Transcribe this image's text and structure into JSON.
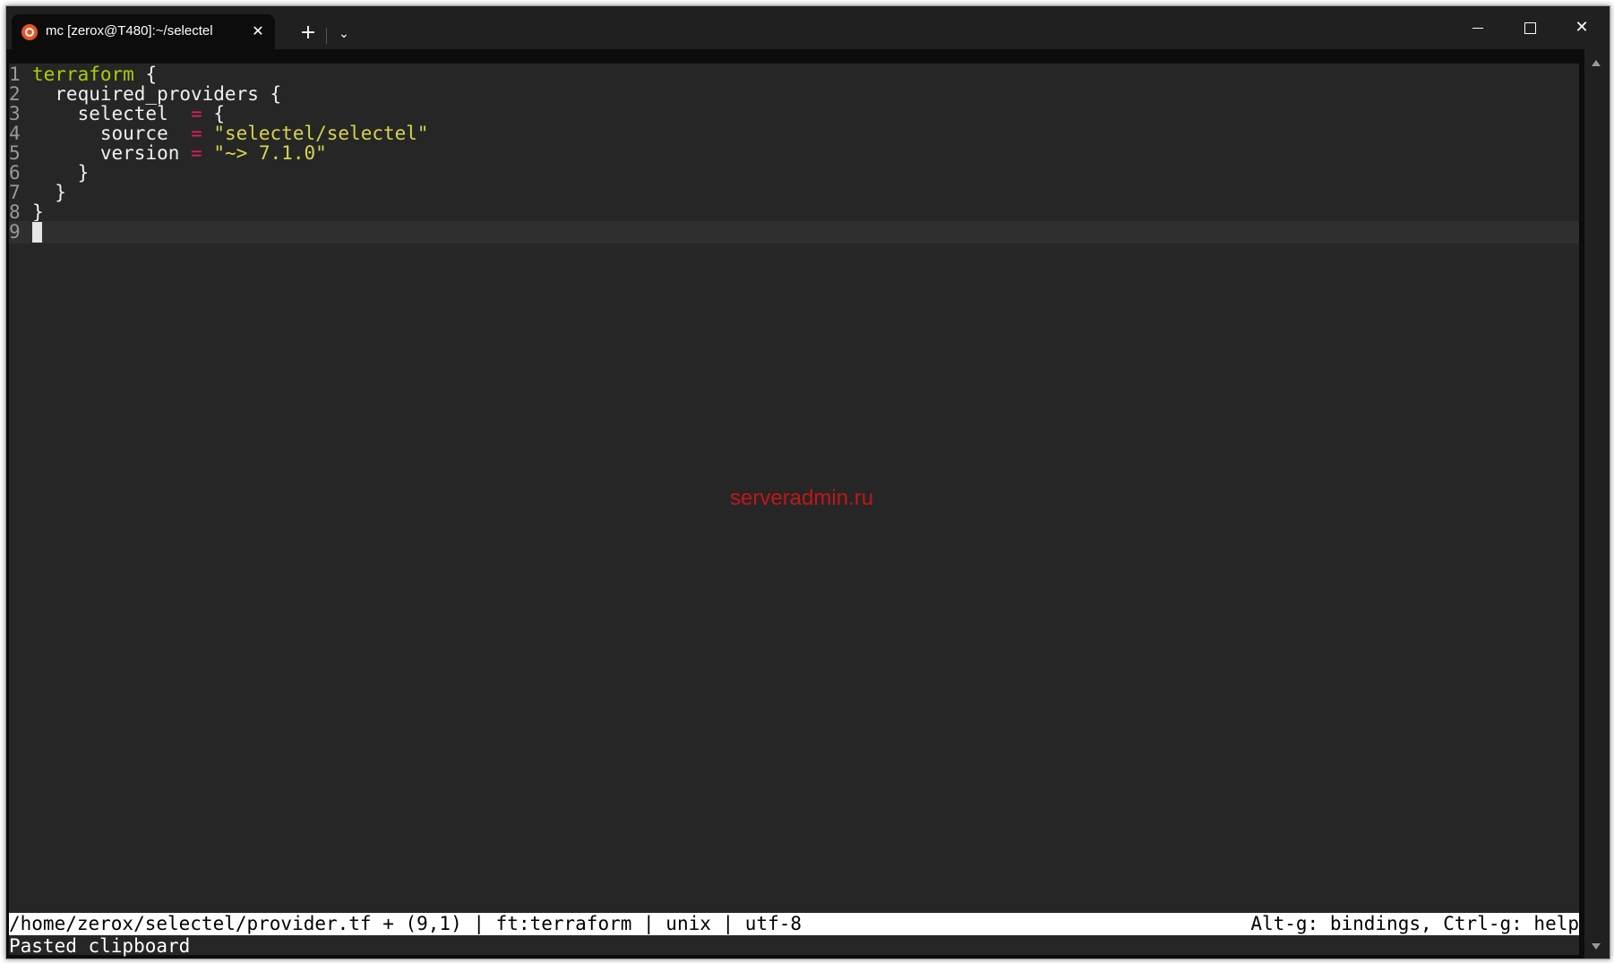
{
  "window": {
    "tab_title": "mc [zerox@T480]:~/selectel",
    "tab_icon": "ubuntu-logo",
    "close_glyph": "✕",
    "new_tab_glyph": "+",
    "dropdown_glyph": "⌄",
    "window_close_glyph": "✕"
  },
  "editor": {
    "lines": [
      {
        "num": "1",
        "tokens": [
          {
            "t": "terraform",
            "c": "kw"
          },
          {
            "t": " {",
            "c": "plain"
          }
        ]
      },
      {
        "num": "2",
        "tokens": [
          {
            "t": "  required_providers {",
            "c": "plain"
          }
        ]
      },
      {
        "num": "3",
        "tokens": [
          {
            "t": "    selectel  ",
            "c": "plain"
          },
          {
            "t": "=",
            "c": "op"
          },
          {
            "t": " {",
            "c": "plain"
          }
        ]
      },
      {
        "num": "4",
        "tokens": [
          {
            "t": "      source  ",
            "c": "plain"
          },
          {
            "t": "=",
            "c": "op"
          },
          {
            "t": " ",
            "c": "plain"
          },
          {
            "t": "\"selectel/selectel\"",
            "c": "str"
          }
        ]
      },
      {
        "num": "5",
        "tokens": [
          {
            "t": "      version ",
            "c": "plain"
          },
          {
            "t": "=",
            "c": "op"
          },
          {
            "t": " ",
            "c": "plain"
          },
          {
            "t": "\"~> 7.1.0\"",
            "c": "str"
          }
        ]
      },
      {
        "num": "6",
        "tokens": [
          {
            "t": "    }",
            "c": "plain"
          }
        ]
      },
      {
        "num": "7",
        "tokens": [
          {
            "t": "  }",
            "c": "plain"
          }
        ]
      },
      {
        "num": "8",
        "tokens": [
          {
            "t": "}",
            "c": "plain"
          }
        ]
      },
      {
        "num": "9",
        "tokens": []
      }
    ],
    "current_line": 9,
    "watermark": "serveradmin.ru"
  },
  "status": {
    "left": "/home/zerox/selectel/provider.tf + (9,1) | ft:terraform | unix | utf-8",
    "right": "Alt-g: bindings, Ctrl-g: help"
  },
  "message": "Pasted clipboard",
  "colors": {
    "keyword": "#a8d000",
    "operator": "#e0205a",
    "string": "#d8d44c",
    "background": "#262626",
    "line_number": "#9a9a9a"
  }
}
